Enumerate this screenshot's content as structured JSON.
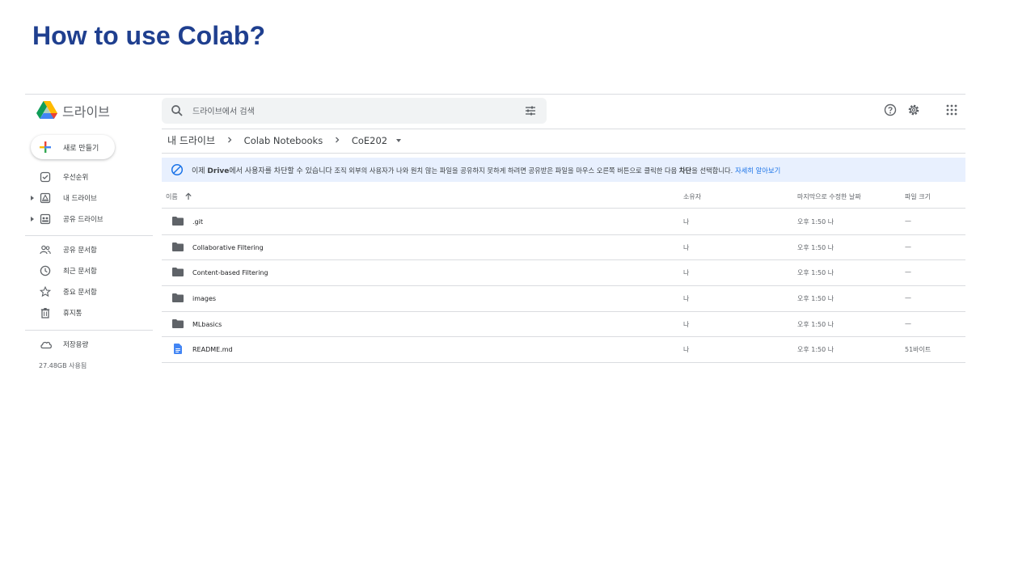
{
  "slide": {
    "title": "How to use Colab?"
  },
  "app": {
    "name": "드라이브"
  },
  "search": {
    "placeholder": "드라이브에서 검색"
  },
  "sidebar": {
    "new_label": "새로 만들기",
    "items": [
      {
        "label": "우선순위",
        "icon": "priority-check-icon"
      },
      {
        "label": "내 드라이브",
        "icon": "my-drive-icon"
      },
      {
        "label": "공유 드라이브",
        "icon": "shared-drives-icon"
      },
      {
        "label": "공유 문서함",
        "icon": "people-icon"
      },
      {
        "label": "최근 문서함",
        "icon": "clock-icon"
      },
      {
        "label": "중요 문서함",
        "icon": "star-icon"
      },
      {
        "label": "휴지통",
        "icon": "trash-icon"
      },
      {
        "label": "저장용량",
        "icon": "cloud-icon"
      }
    ],
    "storage_used": "27.48GB 사용됨"
  },
  "breadcrumb": [
    "내 드라이브",
    "Colab Notebooks",
    "CoE202"
  ],
  "banner": {
    "part1": "이제 ",
    "bold1": "Drive",
    "part2": "에서 사용자를 차단할 수 있습니다",
    "part3": " 조직 외부의 사용자가 나와 원치 않는 파일을 공유하지 못하게 하려면 공유받은 파일을 마우스 오른쪽 버튼으로 클릭한 다음 ",
    "bold2": "차단",
    "part4": "을 선택합니다.",
    "link": "자세히 알아보기"
  },
  "table": {
    "columns": [
      "이름",
      "소유자",
      "마지막으로 수정한 날짜",
      "파일 크기"
    ],
    "rows": [
      {
        "name": ".git",
        "type": "folder",
        "owner": "나",
        "modified": "오후 1:50 나",
        "size": "—"
      },
      {
        "name": "Collaborative Filtering",
        "type": "folder",
        "owner": "나",
        "modified": "오후 1:50 나",
        "size": "—"
      },
      {
        "name": "Content-based Filtering",
        "type": "folder",
        "owner": "나",
        "modified": "오후 1:50 나",
        "size": "—"
      },
      {
        "name": "images",
        "type": "folder",
        "owner": "나",
        "modified": "오후 1:50 나",
        "size": "—"
      },
      {
        "name": "MLbasics",
        "type": "folder",
        "owner": "나",
        "modified": "오후 1:50 나",
        "size": "—"
      },
      {
        "name": "README.md",
        "type": "doc",
        "owner": "나",
        "modified": "오후 1:50 나",
        "size": "51바이트"
      }
    ]
  },
  "colors": {
    "title": "#1f3f8f",
    "accent": "#1a73e8",
    "banner_bg": "#e8f0fe"
  }
}
